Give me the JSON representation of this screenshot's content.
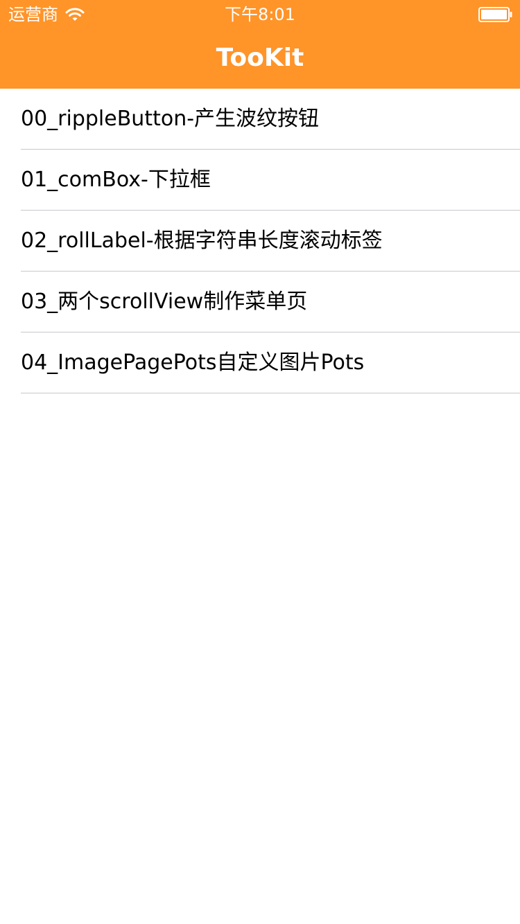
{
  "status_bar": {
    "carrier": "运营商",
    "time": "下午8:01"
  },
  "nav": {
    "title": "TooKit"
  },
  "list": {
    "items": [
      {
        "label": "00_rippleButton-产生波纹按钮"
      },
      {
        "label": "01_comBox-下拉框"
      },
      {
        "label": "02_rollLabel-根据字符串长度滚动标签"
      },
      {
        "label": "03_两个scrollView制作菜单页"
      },
      {
        "label": "04_ImagePagePots自定义图片Pots"
      }
    ]
  },
  "icons": {
    "wifi": "wifi-icon",
    "battery": "battery-icon"
  },
  "colors": {
    "nav_background": "#ff9429",
    "nav_text": "#ffffff",
    "cell_text": "#000000",
    "separator": "#c8c7cc",
    "background": "#ffffff"
  }
}
